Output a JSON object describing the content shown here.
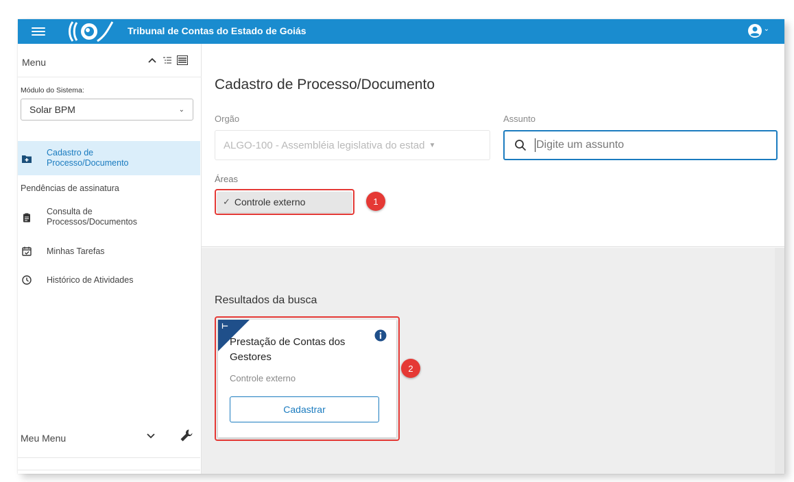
{
  "topbar": {
    "title": "Tribunal de Contas do Estado de Goiás",
    "color": "#1a8ccf"
  },
  "sidebar": {
    "menu_title": "Menu",
    "modulo_label": "Módulo do Sistema:",
    "modulo_value": "Solar BPM",
    "items": [
      {
        "label": "Cadastro de Processo/Documento",
        "icon": "add-folder-icon",
        "active": true
      },
      {
        "label": "Pendências de assinatura"
      },
      {
        "label": "Consulta de Processos/Documentos",
        "icon": "clipboard-icon"
      },
      {
        "label": "Minhas Tarefas",
        "icon": "calendar-check-icon"
      },
      {
        "label": "Histórico de Atividades",
        "icon": "clock-icon"
      }
    ],
    "my_menu": "Meu Menu"
  },
  "main": {
    "page_title": "Cadastro de Processo/Documento",
    "orgao_label": "Orgão",
    "orgao_value": "ALGO-100 - Assembléia legislativa do estad",
    "assunto_label": "Assunto",
    "assunto_placeholder": "Digite um assunto",
    "areas_label": "Áreas",
    "area_chip": "Controle externo",
    "results_title": "Resultados da busca",
    "card": {
      "title": "Prestação de Contas dos Gestores",
      "subtitle": "Controle externo",
      "button": "Cadastrar"
    }
  },
  "annotations": {
    "badge1": "1",
    "badge2": "2",
    "color": "#e53935"
  }
}
